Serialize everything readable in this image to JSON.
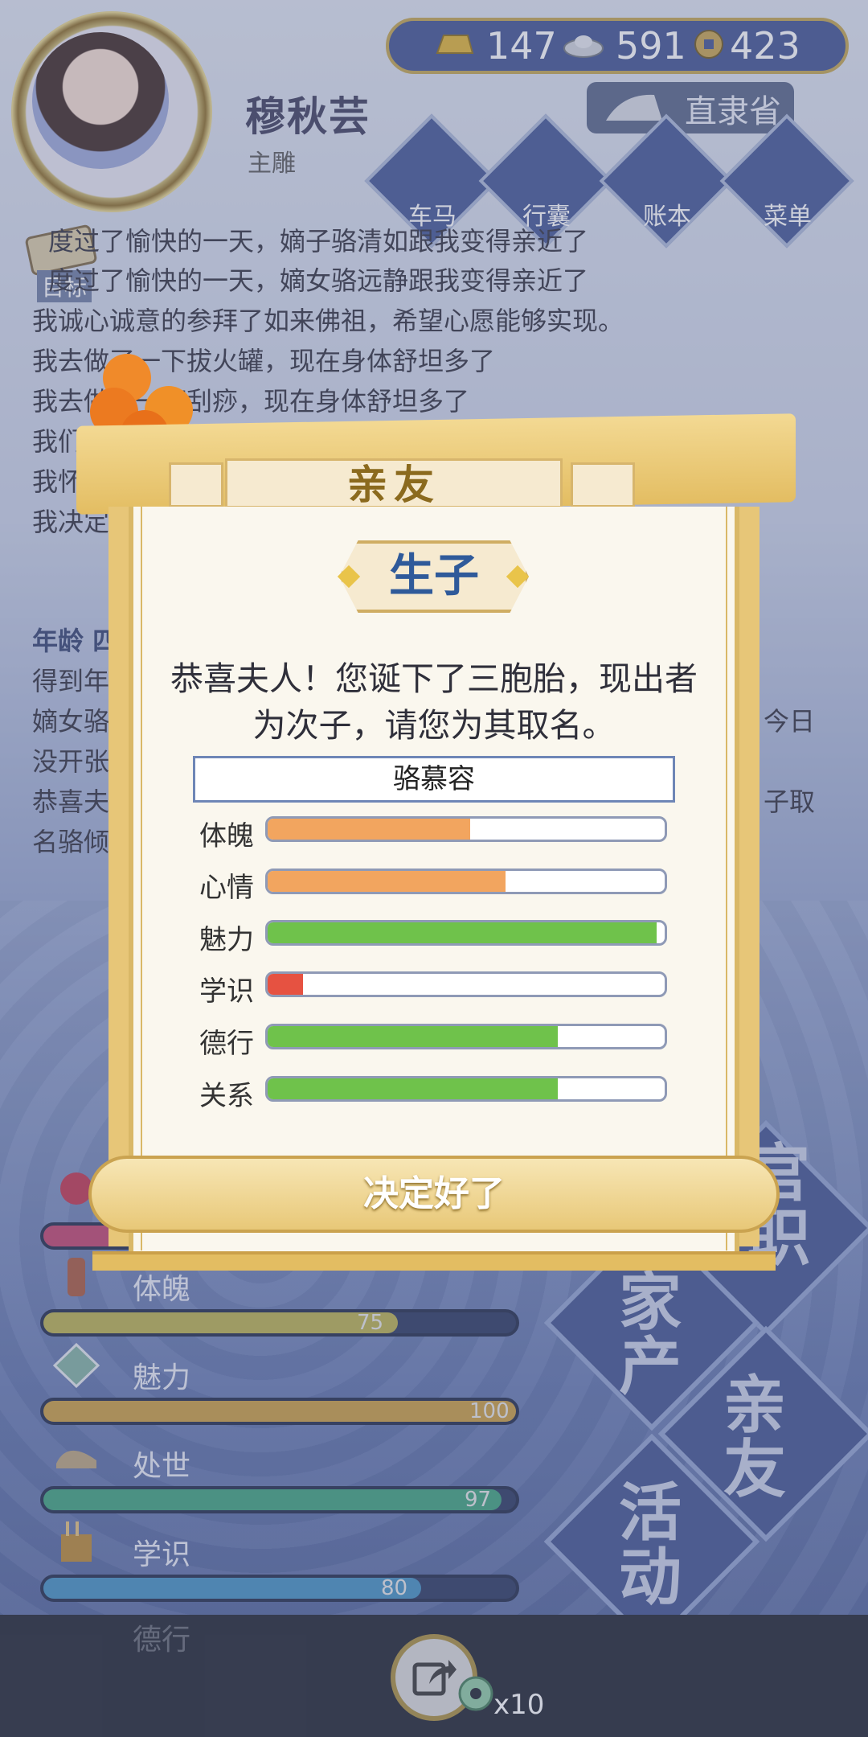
{
  "player": {
    "name": "穆秋芸",
    "title": "主雕",
    "location": "直隶省"
  },
  "resources": [
    {
      "icon": "gold-ingot-icon",
      "value": "147"
    },
    {
      "icon": "silver-ingot-icon",
      "value": "591"
    },
    {
      "icon": "copper-coin-icon",
      "value": "423"
    }
  ],
  "menu": [
    {
      "id": "carriage",
      "label": "车马",
      "icon": "carriage-icon"
    },
    {
      "id": "bag",
      "label": "行囊",
      "icon": "bag-icon"
    },
    {
      "id": "ledger",
      "label": "账本",
      "icon": "ledger-icon"
    },
    {
      "id": "menu",
      "label": "菜单",
      "icon": "more-icon"
    }
  ],
  "goal_label": "目标",
  "log_lines": [
    "度过了愉快的一天，嫡子骆清如跟我变得亲近了",
    "度过了愉快的一天，嫡女骆远静跟我变得亲近了",
    "我诚心诚意的参拜了如来佛祖，希望心愿能够实现。",
    "我去做了一下拔火罐，现在身体舒坦多了",
    "我去做了一下刮痧，现在身体舒坦多了",
    "我们",
    "我怀",
    "我决定",
    "年龄 四",
    "得到年",
    "嫡女骆",
    "没开张",
    "恭喜夫",
    "名骆倾"
  ],
  "log_right": [
    "今日",
    "子取"
  ],
  "stats": [
    {
      "label": "",
      "value": "",
      "fill": 0.75,
      "color": "#c0406a"
    },
    {
      "label": "体魄",
      "value": "75",
      "fill": 0.75,
      "color": "#b9b04a"
    },
    {
      "label": "魅力",
      "value": "100",
      "fill": 1.0,
      "color": "#c99b3c"
    },
    {
      "label": "处世",
      "value": "97",
      "fill": 0.97,
      "color": "#3aa07a"
    },
    {
      "label": "学识",
      "value": "80",
      "fill": 0.8,
      "color": "#3f8ec0"
    },
    {
      "label": "德行",
      "value": "",
      "fill": 0.0,
      "color": "#7a3aa0"
    }
  ],
  "big_menu": [
    {
      "id": "career",
      "text": "官职"
    },
    {
      "id": "property",
      "text": "家产"
    },
    {
      "id": "relatives",
      "text": "亲友"
    },
    {
      "id": "activity",
      "text": "活动"
    }
  ],
  "share": {
    "multiplier": "x10"
  },
  "dialog": {
    "tab_title": "亲友",
    "heading": "生子",
    "message": "恭喜夫人！您诞下了三胞胎，现出者为次子，请您为其取名。",
    "name_value": "骆慕容",
    "attributes": [
      {
        "label": "体魄",
        "value": 0.51,
        "color": "#f2a55f"
      },
      {
        "label": "心情",
        "value": 0.6,
        "color": "#f2a55f"
      },
      {
        "label": "魅力",
        "value": 0.98,
        "color": "#6fc24b"
      },
      {
        "label": "学识",
        "value": 0.09,
        "color": "#e65241"
      },
      {
        "label": "德行",
        "value": 0.73,
        "color": "#6fc24b"
      },
      {
        "label": "关系",
        "value": 0.73,
        "color": "#6fc24b"
      }
    ],
    "confirm_label": "决定好了"
  }
}
